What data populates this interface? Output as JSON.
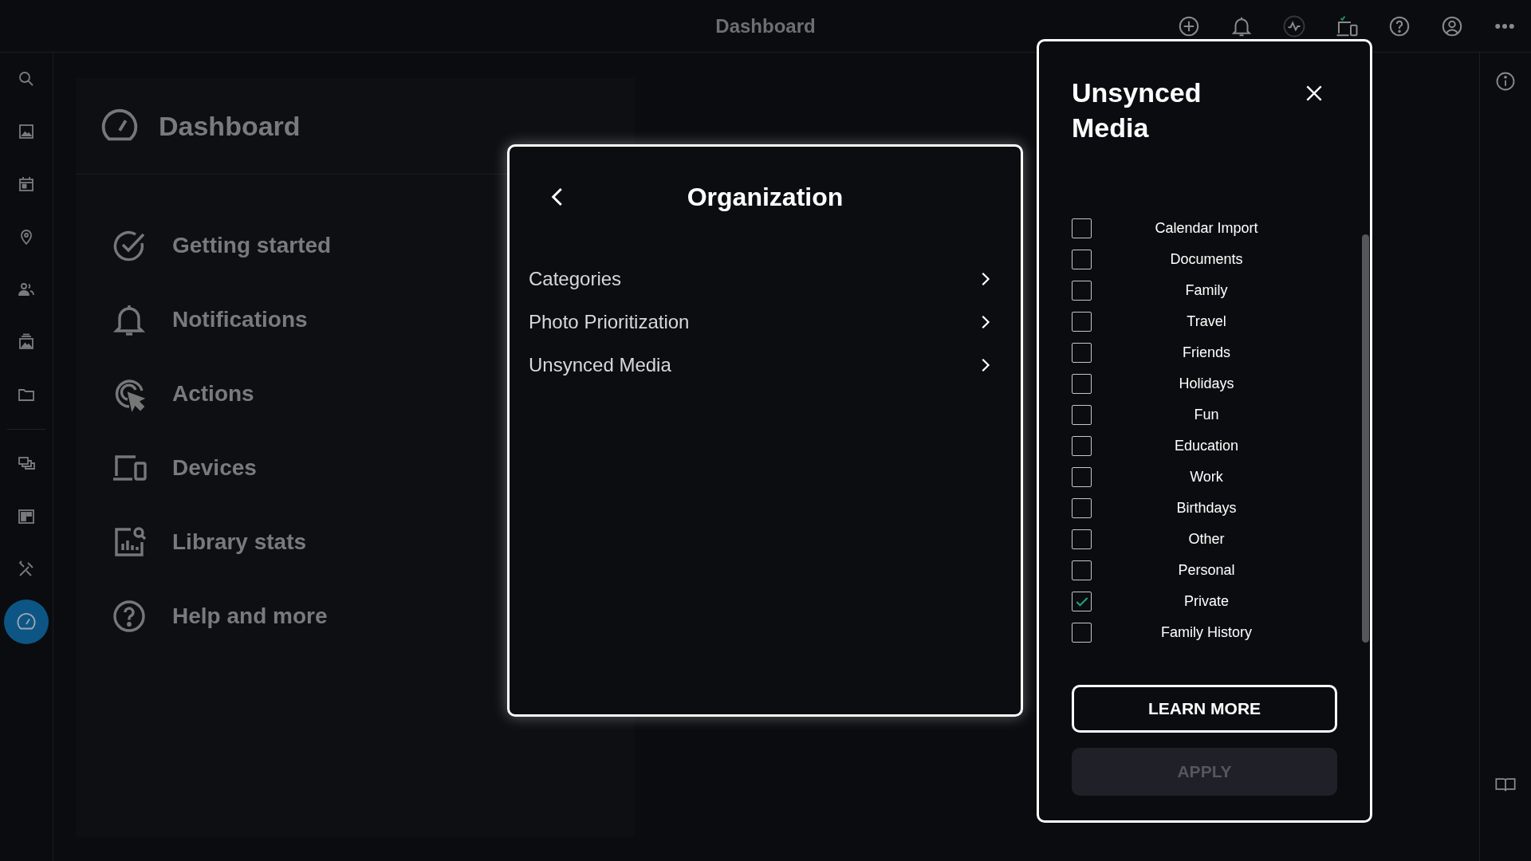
{
  "top_bar": {
    "title": "Dashboard",
    "icons": [
      {
        "kind": "add"
      },
      {
        "kind": "bell"
      },
      {
        "kind": "activity"
      },
      {
        "kind": "devices-check"
      },
      {
        "kind": "help"
      },
      {
        "kind": "account"
      },
      {
        "kind": "more"
      }
    ]
  },
  "left_rail": {
    "groups": [
      {
        "items": [
          {
            "kind": "search",
            "selected": false
          },
          {
            "kind": "image",
            "selected": false
          },
          {
            "kind": "calendar",
            "selected": false
          },
          {
            "kind": "pin",
            "selected": false
          },
          {
            "kind": "people",
            "selected": false
          },
          {
            "kind": "album",
            "selected": false
          },
          {
            "kind": "folder",
            "selected": false
          }
        ]
      },
      {
        "items": [
          {
            "kind": "slides",
            "selected": false
          },
          {
            "kind": "layout",
            "selected": false
          },
          {
            "kind": "tools",
            "selected": false
          },
          {
            "kind": "gauge",
            "selected": true
          }
        ]
      }
    ]
  },
  "dashboard": {
    "title": "Dashboard",
    "items": [
      {
        "label": "Getting started",
        "kind": "check"
      },
      {
        "label": "Notifications",
        "kind": "bell"
      },
      {
        "label": "Actions",
        "kind": "cursor"
      },
      {
        "label": "Devices",
        "kind": "devices"
      },
      {
        "label": "Library stats",
        "kind": "stats"
      },
      {
        "label": "Help and more",
        "kind": "help"
      }
    ]
  },
  "organization_dialog": {
    "title": "Organization",
    "items": [
      "Categories",
      "Photo Prioritization",
      "Unsynced Media"
    ]
  },
  "unsynced_panel": {
    "title": "Unsynced Media",
    "options": [
      {
        "label": "Calendar Import",
        "checked": false
      },
      {
        "label": "Documents",
        "checked": false
      },
      {
        "label": "Family",
        "checked": false
      },
      {
        "label": "Travel",
        "checked": false
      },
      {
        "label": "Friends",
        "checked": false
      },
      {
        "label": "Holidays",
        "checked": false
      },
      {
        "label": "Fun",
        "checked": false
      },
      {
        "label": "Education",
        "checked": false
      },
      {
        "label": "Work",
        "checked": false
      },
      {
        "label": "Birthdays",
        "checked": false
      },
      {
        "label": "Other",
        "checked": false
      },
      {
        "label": "Personal",
        "checked": false
      },
      {
        "label": "Private",
        "checked": true
      },
      {
        "label": "Family History",
        "checked": false
      }
    ],
    "buttons": [
      {
        "label": "LEARN MORE",
        "disabled": false
      },
      {
        "label": "APPLY",
        "disabled": true
      }
    ]
  }
}
